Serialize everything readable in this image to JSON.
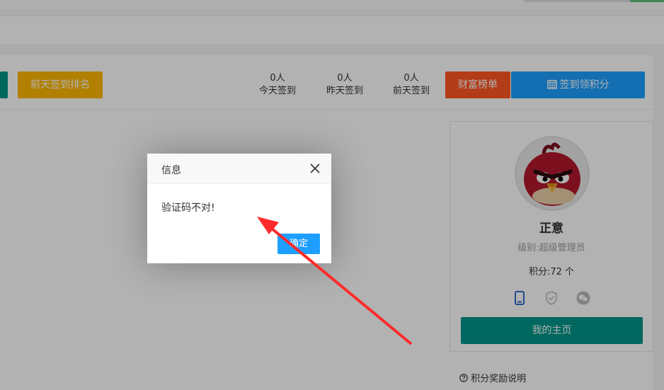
{
  "toolbar": {
    "yesterday_before_rank_label": "前天签到排名",
    "stats": [
      {
        "value": "0人",
        "label": "今天签到"
      },
      {
        "value": "0人",
        "label": "昨天签到"
      },
      {
        "value": "0人",
        "label": "前天签到"
      }
    ],
    "wealth_label": "财富榜单",
    "checkin_label": "签到领积分"
  },
  "profile": {
    "name": "正意",
    "level": "级别:超级管理员",
    "points": "积分:72 个",
    "icons": [
      "tablet-icon",
      "shield-check-icon",
      "wechat-icon"
    ],
    "home_label": "我的主页"
  },
  "rules": {
    "title": "积分奖励说明"
  },
  "dialog": {
    "title": "信息",
    "message": "验证码不对!",
    "ok_label": "确定"
  },
  "colors": {
    "green": "#009688",
    "yellow": "#ffb800",
    "orange": "#ff5722",
    "blue": "#1e9fff",
    "annotation_red": "#ff2a2a"
  }
}
